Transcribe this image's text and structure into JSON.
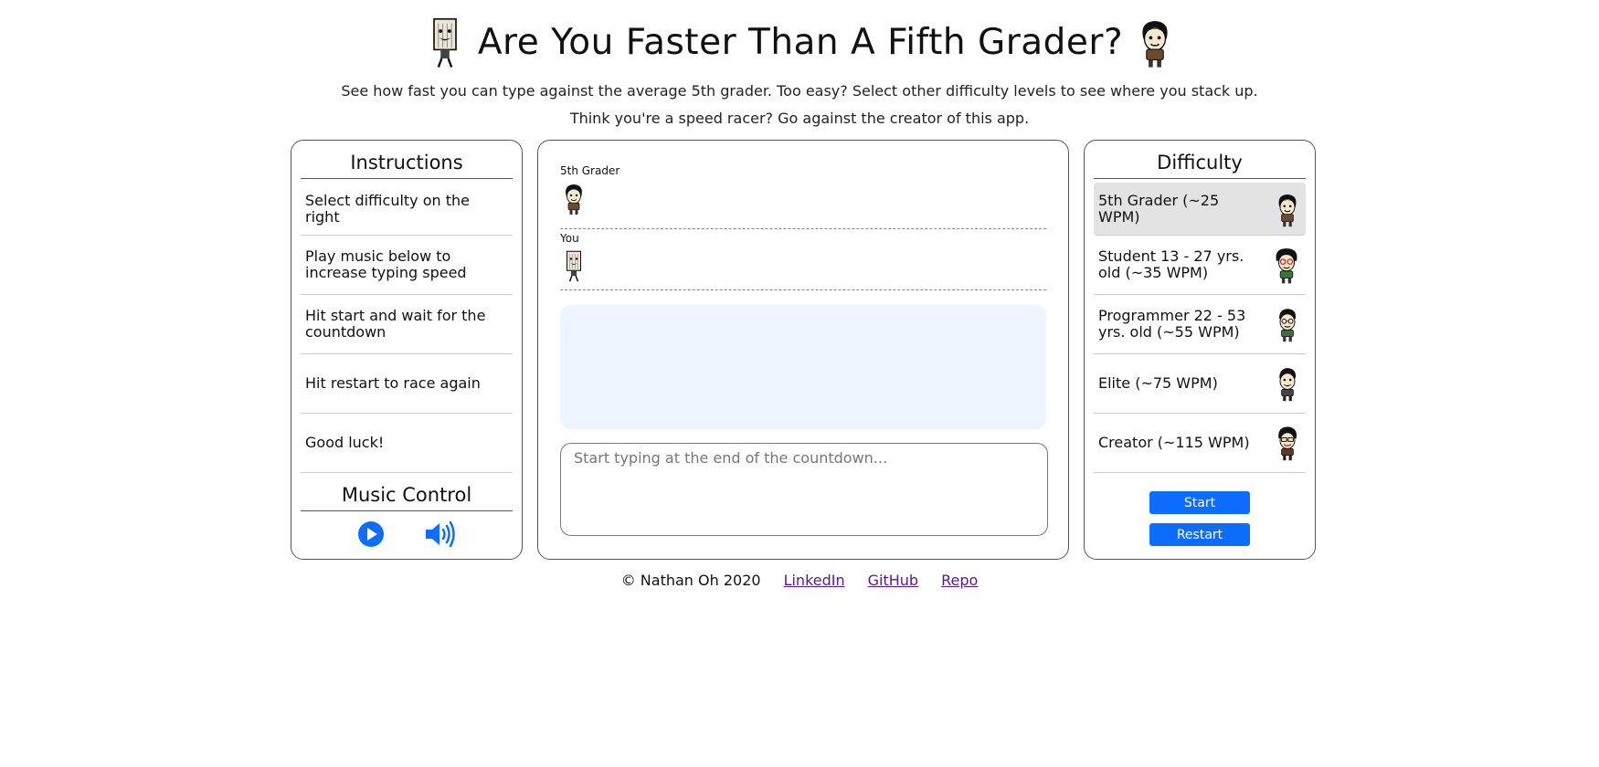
{
  "header": {
    "title": "Are You Faster Than A Fifth Grader?",
    "subtitle1": "See how fast you can type against the average 5th grader. Too easy? Select other difficulty levels to see where you stack up.",
    "subtitle2": "Think you're a speed racer? Go against the creator of this app."
  },
  "instructions": {
    "heading": "Instructions",
    "items": [
      {
        "text": "Select difficulty on the right"
      },
      {
        "text": "Play music below to increase typing speed"
      },
      {
        "text": "Hit start and wait for the countdown"
      },
      {
        "text": "Hit restart to race again"
      },
      {
        "text": "Good luck!"
      }
    ]
  },
  "music": {
    "heading": "Music Control",
    "play_icon": "play-icon",
    "volume_icon": "volume-icon"
  },
  "race": {
    "opponent_label": "5th Grader",
    "player_label": "You",
    "text_passage": "",
    "input_placeholder": "Start typing at the end of the countdown..."
  },
  "difficulty": {
    "heading": "Difficulty",
    "selected": "5th Grader (~25 WPM)",
    "items": [
      {
        "label": "5th Grader (~25 WPM)",
        "icon": "kid-avatar-icon"
      },
      {
        "label": "Student 13 - 27 yrs. old (~35 WPM)",
        "icon": "student-avatar-icon"
      },
      {
        "label": "Programmer 22 - 53 yrs. old (~55 WPM)",
        "icon": "programmer-avatar-icon"
      },
      {
        "label": "Elite (~75 WPM)",
        "icon": "elite-avatar-icon"
      },
      {
        "label": "Creator (~115 WPM)",
        "icon": "creator-avatar-icon"
      }
    ],
    "start_label": "Start",
    "restart_label": "Restart"
  },
  "footer": {
    "copyright": "© Nathan Oh 2020",
    "links": [
      {
        "label": "LinkedIn"
      },
      {
        "label": "GitHub"
      },
      {
        "label": "Repo"
      }
    ]
  },
  "colors": {
    "accent": "#0d6efd",
    "selected_bg": "#e3e3e3",
    "text_box_bg": "#eef5fe",
    "link": "#551a8b"
  }
}
